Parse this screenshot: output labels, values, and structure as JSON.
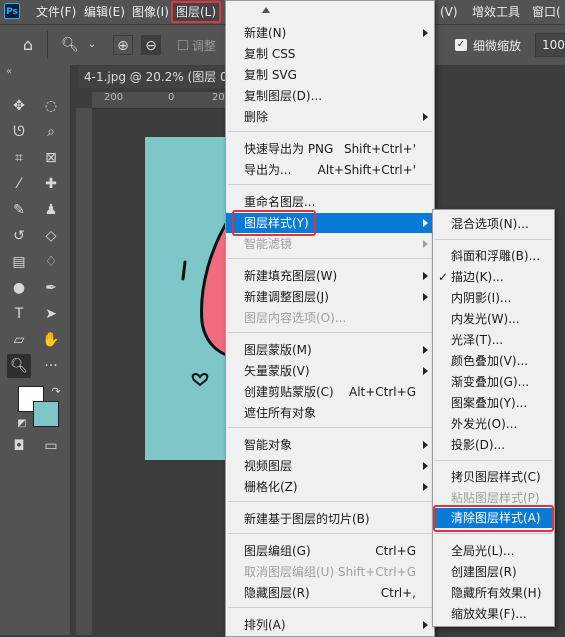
{
  "menubar": {
    "logo": "Ps",
    "items": [
      "文件(F)",
      "编辑(E)",
      "图像(I)",
      "图层(L)",
      "(V)",
      "增效工具",
      "窗口("
    ]
  },
  "options_bar": {
    "checkbox_label": "调整",
    "scrubby_zoom_label": "细微缩放",
    "zoom_value": "100"
  },
  "document_tab": {
    "title": "4-1.jpg @ 20.2% (图层 0,"
  },
  "ruler": {
    "h_labels": [
      "200",
      "0",
      "20"
    ]
  },
  "layer_menu": {
    "items": [
      {
        "label": "新建(N)",
        "shortcut": "",
        "submenu": true,
        "disabled": false
      },
      {
        "label": "复制 CSS",
        "shortcut": "",
        "submenu": false,
        "disabled": false
      },
      {
        "label": "复制 SVG",
        "shortcut": "",
        "submenu": false,
        "disabled": false
      },
      {
        "label": "复制图层(D)...",
        "shortcut": "",
        "submenu": false,
        "disabled": false
      },
      {
        "label": "删除",
        "shortcut": "",
        "submenu": true,
        "disabled": false
      },
      {
        "label": "快速导出为 PNG",
        "shortcut": "Shift+Ctrl+'",
        "submenu": false,
        "disabled": false
      },
      {
        "label": "导出为...",
        "shortcut": "Alt+Shift+Ctrl+'",
        "submenu": false,
        "disabled": false
      },
      {
        "label": "重命名图层...",
        "shortcut": "",
        "submenu": false,
        "disabled": false
      },
      {
        "label": "图层样式(Y)",
        "shortcut": "",
        "submenu": true,
        "disabled": false,
        "selected": true
      },
      {
        "label": "智能滤镜",
        "shortcut": "",
        "submenu": true,
        "disabled": true
      },
      {
        "label": "新建填充图层(W)",
        "shortcut": "",
        "submenu": true,
        "disabled": false
      },
      {
        "label": "新建调整图层(J)",
        "shortcut": "",
        "submenu": true,
        "disabled": false
      },
      {
        "label": "图层内容选项(O)...",
        "shortcut": "",
        "submenu": false,
        "disabled": true
      },
      {
        "label": "图层蒙版(M)",
        "shortcut": "",
        "submenu": true,
        "disabled": false
      },
      {
        "label": "矢量蒙版(V)",
        "shortcut": "",
        "submenu": true,
        "disabled": false
      },
      {
        "label": "创建剪贴蒙版(C)",
        "shortcut": "Alt+Ctrl+G",
        "submenu": false,
        "disabled": false
      },
      {
        "label": "遮住所有对象",
        "shortcut": "",
        "submenu": false,
        "disabled": false
      },
      {
        "label": "智能对象",
        "shortcut": "",
        "submenu": true,
        "disabled": false
      },
      {
        "label": "视频图层",
        "shortcut": "",
        "submenu": true,
        "disabled": false
      },
      {
        "label": "栅格化(Z)",
        "shortcut": "",
        "submenu": true,
        "disabled": false
      },
      {
        "label": "新建基于图层的切片(B)",
        "shortcut": "",
        "submenu": false,
        "disabled": false
      },
      {
        "label": "图层编组(G)",
        "shortcut": "Ctrl+G",
        "submenu": false,
        "disabled": false
      },
      {
        "label": "取消图层编组(U)",
        "shortcut": "Shift+Ctrl+G",
        "submenu": false,
        "disabled": true
      },
      {
        "label": "隐藏图层(R)",
        "shortcut": "Ctrl+,",
        "submenu": false,
        "disabled": false
      },
      {
        "label": "排列(A)",
        "shortcut": "",
        "submenu": true,
        "disabled": false
      }
    ]
  },
  "style_submenu": {
    "items": [
      {
        "label": "混合选项(N)...",
        "disabled": false,
        "checked": false
      },
      {
        "label": "斜面和浮雕(B)...",
        "disabled": false,
        "checked": false
      },
      {
        "label": "描边(K)...",
        "disabled": false,
        "checked": true
      },
      {
        "label": "内阴影(I)...",
        "disabled": false,
        "checked": false
      },
      {
        "label": "内发光(W)...",
        "disabled": false,
        "checked": false
      },
      {
        "label": "光泽(T)...",
        "disabled": false,
        "checked": false
      },
      {
        "label": "颜色叠加(V)...",
        "disabled": false,
        "checked": false
      },
      {
        "label": "渐变叠加(G)...",
        "disabled": false,
        "checked": false
      },
      {
        "label": "图案叠加(Y)...",
        "disabled": false,
        "checked": false
      },
      {
        "label": "外发光(O)...",
        "disabled": false,
        "checked": false
      },
      {
        "label": "投影(D)...",
        "disabled": false,
        "checked": false
      },
      {
        "label": "拷贝图层样式(C)",
        "disabled": false,
        "checked": false
      },
      {
        "label": "粘贴图层样式(P)",
        "disabled": true,
        "checked": false
      },
      {
        "label": "清除图层样式(A)",
        "disabled": false,
        "checked": false,
        "selected": true
      },
      {
        "label": "全局光(L)...",
        "disabled": false,
        "checked": false
      },
      {
        "label": "创建图层(R)",
        "disabled": false,
        "checked": false
      },
      {
        "label": "隐藏所有效果(H)",
        "disabled": false,
        "checked": false
      },
      {
        "label": "缩放效果(F)...",
        "disabled": false,
        "checked": false
      }
    ]
  },
  "colors": {
    "menu_bg": "#f0f0f0",
    "highlight": "#0b7ad6",
    "annotation_red": "#e0353e",
    "canvas_bg": "#7fc6c8",
    "foreground_swatch": "#ffffff",
    "background_swatch": "#7fc6c8"
  }
}
